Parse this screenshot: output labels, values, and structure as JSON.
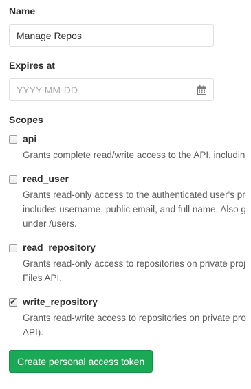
{
  "form": {
    "name": {
      "label": "Name",
      "value": "Manage Repos"
    },
    "expires": {
      "label": "Expires at",
      "placeholder": "YYYY-MM-DD",
      "icon": "calendar-icon"
    },
    "scopes": {
      "label": "Scopes",
      "items": [
        {
          "name": "api",
          "checked": false,
          "lines": [
            "Grants complete read/write access to the API, includin"
          ]
        },
        {
          "name": "read_user",
          "checked": false,
          "lines": [
            "Grants read-only access to the authenticated user's pr",
            "includes username, public email, and full name. Also g",
            "under /users."
          ]
        },
        {
          "name": "read_repository",
          "checked": false,
          "lines": [
            "Grants read-only access to repositories on private proj",
            "Files API."
          ]
        },
        {
          "name": "write_repository",
          "checked": true,
          "lines": [
            "Grants read-write access to repositories on private pro",
            "API)."
          ]
        }
      ]
    },
    "submit_label": "Create personal access token"
  }
}
